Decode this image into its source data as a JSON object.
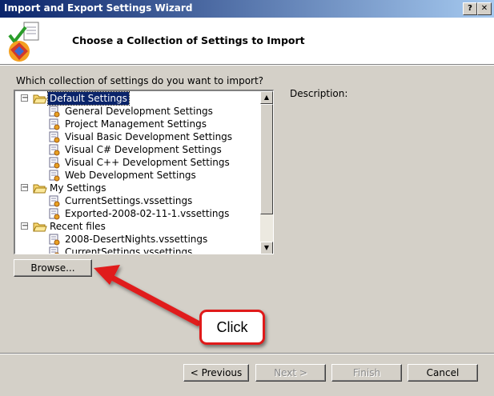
{
  "window": {
    "title": "Import and Export Settings Wizard",
    "help_label": "?",
    "close_label": "✕"
  },
  "header": {
    "title": "Choose a Collection of Settings to Import"
  },
  "prompt": "Which collection of settings do you want to import?",
  "description_label": "Description:",
  "tree": {
    "groups": [
      {
        "label": "Default Settings",
        "expanded": true,
        "selected": true,
        "items": [
          "General Development Settings",
          "Project Management Settings",
          "Visual Basic Development Settings",
          "Visual C# Development Settings",
          "Visual C++ Development Settings",
          "Web Development Settings"
        ]
      },
      {
        "label": "My Settings",
        "expanded": true,
        "items": [
          "CurrentSettings.vssettings",
          "Exported-2008-02-11-1.vssettings"
        ]
      },
      {
        "label": "Recent files",
        "expanded": true,
        "items": [
          "2008-DesertNights.vssettings",
          "CurrentSettings.vssettings"
        ]
      }
    ],
    "expander_symbol": "−"
  },
  "buttons": {
    "browse": "Browse...",
    "previous": "< Previous",
    "next": "Next >",
    "finish": "Finish",
    "cancel": "Cancel"
  },
  "callout": {
    "text": "Click"
  },
  "colors": {
    "accent": "#0a246a",
    "callout_red": "#e01a1a"
  }
}
